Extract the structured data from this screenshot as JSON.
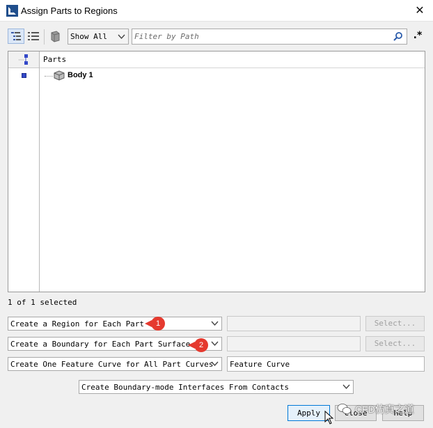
{
  "window": {
    "title": "Assign Parts to Regions",
    "close_glyph": "✕"
  },
  "toolbar": {
    "tree_view_icon": "tree-view-icon",
    "list_view_icon": "list-view-icon",
    "part_icon": "part-icon",
    "show_filter": "Show All",
    "filter_placeholder": "Filter by Path",
    "regex_label": ".*"
  },
  "tree": {
    "column_header": "Parts",
    "rows": [
      {
        "label": "Body 1",
        "icon": "body-part-icon",
        "selected": true
      }
    ]
  },
  "status": {
    "selection_text": "1 of 1 selected"
  },
  "options": {
    "region_mode": "Create a Region for Each Part",
    "boundary_mode": "Create a Boundary for Each Part Surface",
    "feature_curve_mode": "Create One Feature Curve for All Part Curves",
    "region_name": "",
    "boundary_name": "",
    "feature_curve_name": "Feature Curve",
    "select_label_1": "Select...",
    "select_label_2": "Select...",
    "interface_mode": "Create Boundary-mode Interfaces From Contacts"
  },
  "annotations": {
    "callout_1": "1",
    "callout_2": "2",
    "color": "#e53a2f"
  },
  "buttons": {
    "apply": "Apply",
    "close": "Close",
    "help": "Help"
  },
  "watermark": {
    "text": "CFD仿真之道"
  },
  "colors": {
    "accent": "#0078d7",
    "selection_marker": "#3348c8"
  }
}
